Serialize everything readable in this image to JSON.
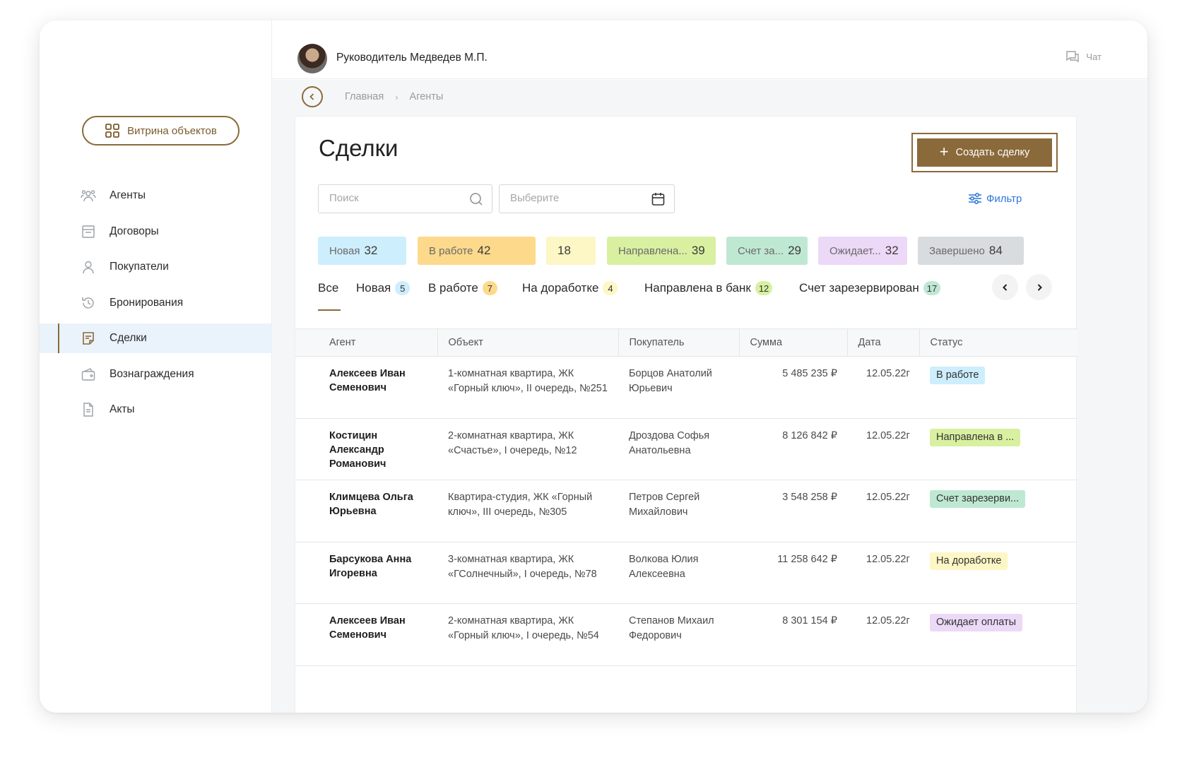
{
  "colors": {
    "brand": "#8a6a3a",
    "link": "#2d77d8",
    "active_nav_bg": "#eaf3fb"
  },
  "sidebar": {
    "showcase_button": {
      "label": "Витрина объектов",
      "icon": "grid-icon"
    },
    "items": [
      {
        "label": "Агенты",
        "icon": "agents-icon"
      },
      {
        "label": "Договоры",
        "icon": "contracts-icon"
      },
      {
        "label": "Покупатели",
        "icon": "buyers-icon"
      },
      {
        "label": "Бронирования",
        "icon": "history-icon"
      },
      {
        "label": "Сделки",
        "icon": "deals-icon",
        "active": true
      },
      {
        "label": "Вознаграждения",
        "icon": "wallet-icon"
      },
      {
        "label": "Акты",
        "icon": "document-icon"
      }
    ]
  },
  "topbar": {
    "user_name": "Руководитель Медведев М.П.",
    "chat_label": "Чат"
  },
  "breadcrumb": {
    "home": "Главная",
    "current": "Агенты"
  },
  "main": {
    "title": "Сделки",
    "create_button": "Создать сделку",
    "search_placeholder": "Поиск",
    "date_placeholder": "Выберите",
    "filter_label": "Фильтр"
  },
  "status_chips": [
    {
      "label": "Новая",
      "count": "32",
      "color": "#cdeefc"
    },
    {
      "label": "В работе",
      "count": "42",
      "color": "#fdd98c"
    },
    {
      "label": "",
      "count": "18",
      "color": "#fdf6c5"
    },
    {
      "label": "Направлена...",
      "count": "39",
      "color": "#d8f0a0"
    },
    {
      "label": "Счет за...",
      "count": "29",
      "color": "#bfe8d3"
    },
    {
      "label": "Ожидает...",
      "count": "32",
      "color": "#ecd8f7"
    },
    {
      "label": "Завершено",
      "count": "84",
      "color": "#d8dcdf"
    }
  ],
  "tabs": [
    {
      "label": "Все",
      "count": ""
    },
    {
      "label": "Новая",
      "count": "5",
      "color": "#cdeefc"
    },
    {
      "label": "В работе",
      "count": "7",
      "color": "#fdd98c"
    },
    {
      "label": "На доработке",
      "count": "4",
      "color": "#fdf6c5"
    },
    {
      "label": "Направлена в банк",
      "count": "12",
      "color": "#d8f0a0"
    },
    {
      "label": "Счет зарезервирован",
      "count": "17",
      "color": "#bfe8d3"
    }
  ],
  "table": {
    "columns": [
      "Агент",
      "Объект",
      "Покупатель",
      "Сумма",
      "Дата",
      "Статус"
    ],
    "rows": [
      {
        "agent": "Алексеев Иван Семенович",
        "object": "1-комнатная квартира, ЖК «Горный ключ», II очередь, №251",
        "buyer": "Борцов Анатолий Юрьевич",
        "sum": "5 485 235 ₽",
        "date": "12.05.22г",
        "status": "В работе",
        "status_color": "#cdeefc"
      },
      {
        "agent": "Костицин Александр Романович",
        "object": "2-комнатная квартира, ЖК «Счастье», I очередь, №12",
        "buyer": "Дроздова Софья Анатольевна",
        "sum": "8 126 842 ₽",
        "date": "12.05.22г",
        "status": "Направлена в ...",
        "status_color": "#d8f0a0"
      },
      {
        "agent": "Климцева Ольга Юрьевна",
        "object": "Квартира-студия, ЖК «Горный ключ», III очередь, №305",
        "buyer": "Петров Сергей Михайлович",
        "sum": "3 548 258 ₽",
        "date": "12.05.22г",
        "status": "Счет зарезерви...",
        "status_color": "#bfe8d3"
      },
      {
        "agent": "Барсукова Анна Игоревна",
        "object": "3-комнатная квартира, ЖК «ГСолнечный», I очередь, №78",
        "buyer": "Волкова Юлия Алексеевна",
        "sum": "11 258 642 ₽",
        "date": "12.05.22г",
        "status": "На доработке",
        "status_color": "#fdf6c5"
      },
      {
        "agent": "Алексеев Иван Семенович",
        "object": "2-комнатная квартира, ЖК «Горный ключ», I очередь, №54",
        "buyer": "Степанов Михаил Федорович",
        "sum": "8 301 154 ₽",
        "date": "12.05.22г",
        "status": "Ожидает оплаты",
        "status_color": "#ecd8f7"
      }
    ]
  }
}
